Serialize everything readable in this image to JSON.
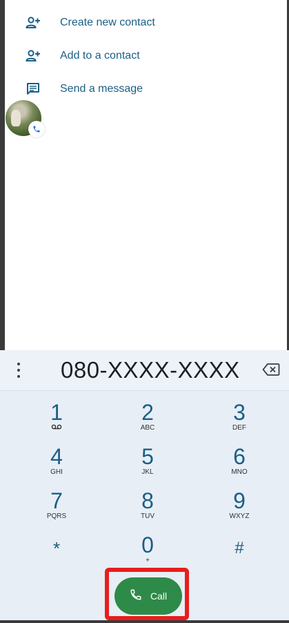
{
  "options": [
    {
      "label": "Create new contact",
      "icon": "person-add-icon"
    },
    {
      "label": "Add to a contact",
      "icon": "person-add-icon"
    },
    {
      "label": "Send a message",
      "icon": "message-icon"
    }
  ],
  "contact_avatar": {
    "icon": "avatar-photo",
    "badge_icon": "phone-icon"
  },
  "dialer": {
    "number": "080-XXXX-XXXX",
    "menu_icon": "more-vert-icon",
    "backspace_icon": "backspace-icon",
    "keys": [
      {
        "digit": "1",
        "letters": ""
      },
      {
        "digit": "2",
        "letters": "ABC"
      },
      {
        "digit": "3",
        "letters": "DEF"
      },
      {
        "digit": "4",
        "letters": "GHI"
      },
      {
        "digit": "5",
        "letters": "JKL"
      },
      {
        "digit": "6",
        "letters": "MNO"
      },
      {
        "digit": "7",
        "letters": "PQRS"
      },
      {
        "digit": "8",
        "letters": "TUV"
      },
      {
        "digit": "9",
        "letters": "WXYZ"
      },
      {
        "digit": "*",
        "letters": ""
      },
      {
        "digit": "0",
        "letters": "+"
      },
      {
        "digit": "#",
        "letters": ""
      }
    ],
    "call_label": "Call",
    "call_icon": "phone-icon",
    "colors": {
      "accent": "#1a5f86",
      "call": "#2e8a48",
      "highlight": "#e81d1d"
    }
  }
}
